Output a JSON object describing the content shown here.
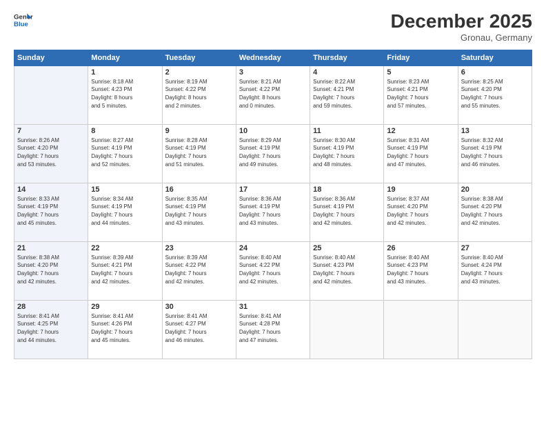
{
  "header": {
    "logo_line1": "General",
    "logo_line2": "Blue",
    "title": "December 2025",
    "location": "Gronau, Germany"
  },
  "days_of_week": [
    "Sunday",
    "Monday",
    "Tuesday",
    "Wednesday",
    "Thursday",
    "Friday",
    "Saturday"
  ],
  "weeks": [
    [
      {
        "day": "",
        "info": ""
      },
      {
        "day": "1",
        "info": "Sunrise: 8:18 AM\nSunset: 4:23 PM\nDaylight: 8 hours\nand 5 minutes."
      },
      {
        "day": "2",
        "info": "Sunrise: 8:19 AM\nSunset: 4:22 PM\nDaylight: 8 hours\nand 2 minutes."
      },
      {
        "day": "3",
        "info": "Sunrise: 8:21 AM\nSunset: 4:22 PM\nDaylight: 8 hours\nand 0 minutes."
      },
      {
        "day": "4",
        "info": "Sunrise: 8:22 AM\nSunset: 4:21 PM\nDaylight: 7 hours\nand 59 minutes."
      },
      {
        "day": "5",
        "info": "Sunrise: 8:23 AM\nSunset: 4:21 PM\nDaylight: 7 hours\nand 57 minutes."
      },
      {
        "day": "6",
        "info": "Sunrise: 8:25 AM\nSunset: 4:20 PM\nDaylight: 7 hours\nand 55 minutes."
      }
    ],
    [
      {
        "day": "7",
        "info": "Sunrise: 8:26 AM\nSunset: 4:20 PM\nDaylight: 7 hours\nand 53 minutes."
      },
      {
        "day": "8",
        "info": "Sunrise: 8:27 AM\nSunset: 4:19 PM\nDaylight: 7 hours\nand 52 minutes."
      },
      {
        "day": "9",
        "info": "Sunrise: 8:28 AM\nSunset: 4:19 PM\nDaylight: 7 hours\nand 51 minutes."
      },
      {
        "day": "10",
        "info": "Sunrise: 8:29 AM\nSunset: 4:19 PM\nDaylight: 7 hours\nand 49 minutes."
      },
      {
        "day": "11",
        "info": "Sunrise: 8:30 AM\nSunset: 4:19 PM\nDaylight: 7 hours\nand 48 minutes."
      },
      {
        "day": "12",
        "info": "Sunrise: 8:31 AM\nSunset: 4:19 PM\nDaylight: 7 hours\nand 47 minutes."
      },
      {
        "day": "13",
        "info": "Sunrise: 8:32 AM\nSunset: 4:19 PM\nDaylight: 7 hours\nand 46 minutes."
      }
    ],
    [
      {
        "day": "14",
        "info": "Sunrise: 8:33 AM\nSunset: 4:19 PM\nDaylight: 7 hours\nand 45 minutes."
      },
      {
        "day": "15",
        "info": "Sunrise: 8:34 AM\nSunset: 4:19 PM\nDaylight: 7 hours\nand 44 minutes."
      },
      {
        "day": "16",
        "info": "Sunrise: 8:35 AM\nSunset: 4:19 PM\nDaylight: 7 hours\nand 43 minutes."
      },
      {
        "day": "17",
        "info": "Sunrise: 8:36 AM\nSunset: 4:19 PM\nDaylight: 7 hours\nand 43 minutes."
      },
      {
        "day": "18",
        "info": "Sunrise: 8:36 AM\nSunset: 4:19 PM\nDaylight: 7 hours\nand 42 minutes."
      },
      {
        "day": "19",
        "info": "Sunrise: 8:37 AM\nSunset: 4:20 PM\nDaylight: 7 hours\nand 42 minutes."
      },
      {
        "day": "20",
        "info": "Sunrise: 8:38 AM\nSunset: 4:20 PM\nDaylight: 7 hours\nand 42 minutes."
      }
    ],
    [
      {
        "day": "21",
        "info": "Sunrise: 8:38 AM\nSunset: 4:20 PM\nDaylight: 7 hours\nand 42 minutes."
      },
      {
        "day": "22",
        "info": "Sunrise: 8:39 AM\nSunset: 4:21 PM\nDaylight: 7 hours\nand 42 minutes."
      },
      {
        "day": "23",
        "info": "Sunrise: 8:39 AM\nSunset: 4:22 PM\nDaylight: 7 hours\nand 42 minutes."
      },
      {
        "day": "24",
        "info": "Sunrise: 8:40 AM\nSunset: 4:22 PM\nDaylight: 7 hours\nand 42 minutes."
      },
      {
        "day": "25",
        "info": "Sunrise: 8:40 AM\nSunset: 4:23 PM\nDaylight: 7 hours\nand 42 minutes."
      },
      {
        "day": "26",
        "info": "Sunrise: 8:40 AM\nSunset: 4:23 PM\nDaylight: 7 hours\nand 43 minutes."
      },
      {
        "day": "27",
        "info": "Sunrise: 8:40 AM\nSunset: 4:24 PM\nDaylight: 7 hours\nand 43 minutes."
      }
    ],
    [
      {
        "day": "28",
        "info": "Sunrise: 8:41 AM\nSunset: 4:25 PM\nDaylight: 7 hours\nand 44 minutes."
      },
      {
        "day": "29",
        "info": "Sunrise: 8:41 AM\nSunset: 4:26 PM\nDaylight: 7 hours\nand 45 minutes."
      },
      {
        "day": "30",
        "info": "Sunrise: 8:41 AM\nSunset: 4:27 PM\nDaylight: 7 hours\nand 46 minutes."
      },
      {
        "day": "31",
        "info": "Sunrise: 8:41 AM\nSunset: 4:28 PM\nDaylight: 7 hours\nand 47 minutes."
      },
      {
        "day": "",
        "info": ""
      },
      {
        "day": "",
        "info": ""
      },
      {
        "day": "",
        "info": ""
      }
    ]
  ]
}
